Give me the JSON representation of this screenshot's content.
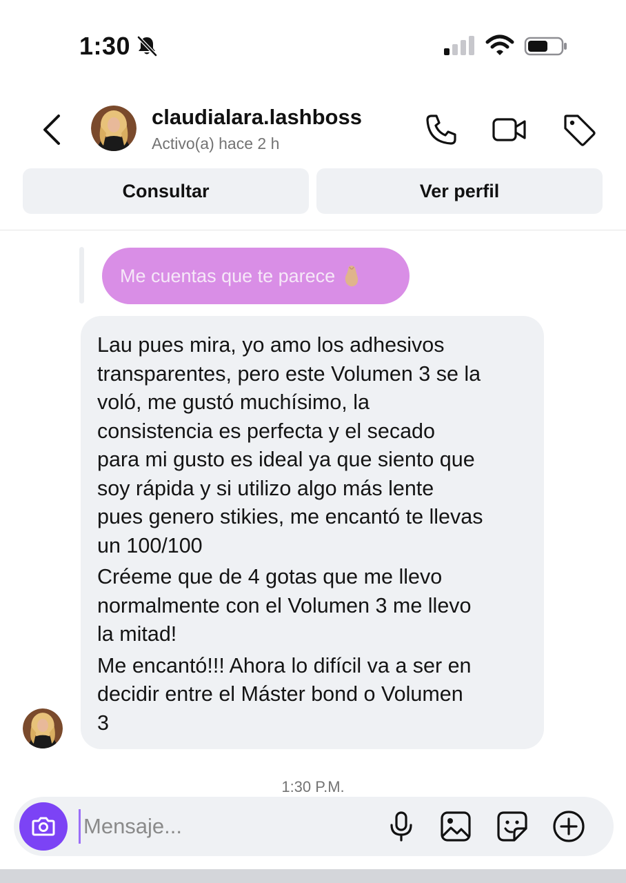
{
  "status_bar": {
    "time": "1:30",
    "icons": [
      "bell-slash-icon",
      "cellular-signal-icon",
      "wifi-icon",
      "battery-icon"
    ]
  },
  "header": {
    "username": "claudialara.lashboss",
    "activity": "Activo(a) hace 2 h",
    "icons": [
      "back-chevron-icon",
      "phone-icon",
      "video-camera-icon",
      "tag-icon"
    ]
  },
  "actions": {
    "consultar": "Consultar",
    "ver_perfil": "Ver perfil"
  },
  "conversation": {
    "sent_message": "Me cuentas que te parece",
    "sent_emoji": "pinched-fingers-emoji",
    "received_paragraphs": [
      "Lau pues mira, yo amo los adhesivos\ntransparentes, pero este Volumen 3 se la\nvoló, me gustó muchísimo, la\nconsistencia es perfecta y el secado\npara mi gusto es ideal ya que siento que\nsoy rápida y si utilizo algo más lente\npues genero stikies, me encantó te llevas\nun 100/100",
      "Créeme que de 4 gotas que me llevo\nnormalmente con el Volumen 3 me llevo\nla mitad!",
      "Me encantó!!! Ahora lo difícil va a ser en\ndecidir entre el Máster bond o Volumen\n3"
    ],
    "timestamp": "1:30 P.M."
  },
  "composer": {
    "placeholder": "Mensaje...",
    "icons": [
      "camera-icon",
      "microphone-icon",
      "gallery-icon",
      "sticker-icon",
      "plus-circle-icon"
    ]
  },
  "colors": {
    "sent_bubble": "#d98ee6",
    "received_bubble": "#eff1f4",
    "camera_button": "#7c43f5",
    "secondary_text": "#737373"
  }
}
